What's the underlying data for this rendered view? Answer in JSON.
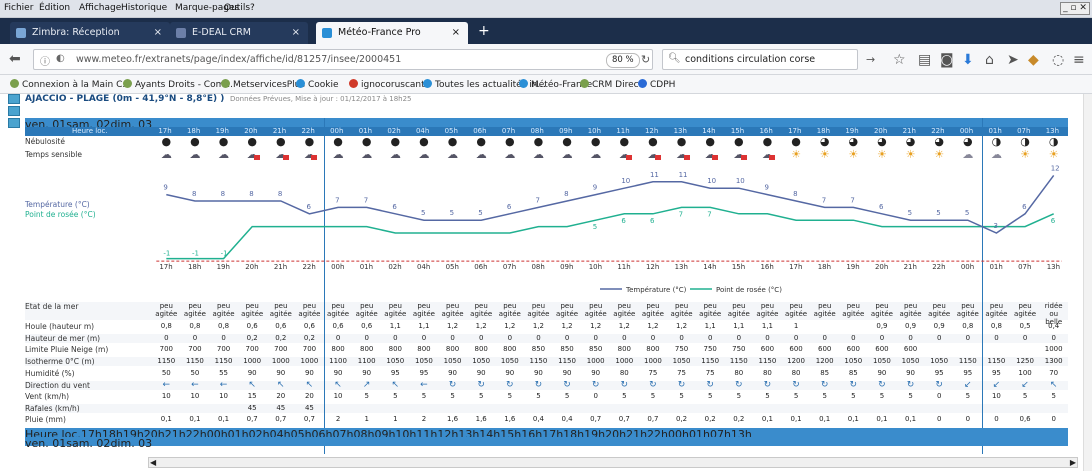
{
  "menu": [
    "Fichier",
    "Édition",
    "Affichage",
    "Historique",
    "Marque-pages",
    "Outils",
    "?"
  ],
  "tabs": [
    {
      "label": "Zimbra: Réception",
      "icon": "zimbra-icon",
      "color": "#7aa6d6",
      "active": false
    },
    {
      "label": "E-DEAL CRM",
      "icon": "edeal-icon",
      "color": "#6c7fa8",
      "active": false
    },
    {
      "label": "Météo-France Pro",
      "icon": "meteo-icon",
      "color": "#2a8fd6",
      "active": true
    }
  ],
  "nav": {
    "url": "www.meteo.fr/extranets/page/index/affiche/id/81257/insee/2000451",
    "zoom": "80 %",
    "search": "conditions circulation corse"
  },
  "bookmarks": [
    "Connexion à la Main C...",
    "Ayants Droits - Com...",
    "MetservicesPlus",
    "Cookie",
    "ignocoruscant",
    "Toutes les actualités in...",
    "Météo-France",
    "CRM Direct",
    "CDPH"
  ],
  "page": {
    "title": "AJACCIO - PLAGE (0m - 41,9°N - 8,8°E) )",
    "subtitle": "Données Prévues,      Mise à jour : 01/12/2017 à 18h25",
    "days": [
      {
        "label": "ven. 01",
        "span": 6
      },
      {
        "label": "sam. 02",
        "span": 23
      },
      {
        "label": "dim. 03",
        "span": 4
      }
    ],
    "hour_label": "Heure loc.",
    "hours": [
      "17h",
      "18h",
      "19h",
      "20h",
      "21h",
      "22h",
      "00h",
      "01h",
      "02h",
      "04h",
      "05h",
      "06h",
      "07h",
      "08h",
      "09h",
      "10h",
      "11h",
      "12h",
      "13h",
      "14h",
      "15h",
      "16h",
      "17h",
      "18h",
      "19h",
      "20h",
      "21h",
      "22h",
      "00h",
      "01h",
      "07h",
      "13h"
    ],
    "row_labels": {
      "nebulosite": "Nébulosité",
      "temps": "Temps sensible",
      "temperature": "Température (°C)",
      "rosee": "Point de rosée (°C)",
      "etat_mer": "Etat de la mer",
      "houle": "Houle (hauteur m)",
      "hauteur_mer": "Hauteur de mer (m)",
      "pluie_neige": "Limite Pluie Neige (m)",
      "isotherme": "Isotherme 0°C (m)",
      "humidite": "Humidité (%)",
      "direction_vent": "Direction du vent",
      "vent": "Vent (km/h)",
      "rafales": "Rafales (km/h)",
      "pluie": "Pluie (mm)"
    },
    "legend": {
      "temperature": "Température (°C)",
      "rosee": "Point de rosée (°C)"
    },
    "colors": {
      "header": "#2b78b8",
      "temp": "#5568a3",
      "dew": "#20b090",
      "freeze": "#cc3333"
    },
    "temperature": [
      9,
      8,
      8,
      8,
      8,
      6,
      7,
      7,
      6,
      5,
      5,
      5,
      6,
      7,
      8,
      9,
      10,
      11,
      11,
      10,
      10,
      9,
      8,
      7,
      7,
      6,
      5,
      5,
      5,
      3,
      6,
      12
    ],
    "temp_labels": [
      "9",
      "8",
      "8",
      "8",
      "8",
      "6",
      "7",
      "7",
      "6",
      "5",
      "5",
      "5",
      "6",
      "7",
      "8",
      "9",
      "10",
      "11",
      "11",
      "10",
      "10",
      "9",
      "8",
      "7",
      "7",
      "6",
      "5",
      "5",
      "5",
      "3",
      "6",
      "12"
    ],
    "dew": [
      -1,
      -1,
      -1,
      4,
      4,
      4,
      4,
      4,
      3,
      3,
      3,
      3,
      3,
      4,
      4,
      5,
      6,
      6,
      7,
      7,
      6,
      6,
      5,
      5,
      5,
      4,
      4,
      4,
      4,
      4,
      4,
      6
    ],
    "dew_labels": [
      "-1",
      "-1",
      "-1",
      "",
      "",
      "",
      "",
      "",
      "",
      "",
      "",
      "",
      "",
      "",
      "",
      "5",
      "6",
      "6",
      "7",
      "7",
      "",
      "",
      "",
      "",
      "",
      "",
      "",
      "",
      "",
      "",
      "",
      "6"
    ],
    "nebulosite": [
      "full",
      "full",
      "full",
      "full",
      "full",
      "full",
      "full",
      "full",
      "full",
      "full",
      "full",
      "full",
      "full",
      "full",
      "full",
      "full",
      "full",
      "full",
      "full",
      "full",
      "full",
      "full",
      "full",
      "3q",
      "3q",
      "3q",
      "3q",
      "3q",
      "3q",
      "half",
      "half",
      "half"
    ],
    "temps": [
      "rain",
      "rain",
      "rain",
      "storm",
      "storm",
      "storm",
      "rain",
      "rain",
      "rain",
      "rain",
      "rain",
      "rain",
      "rain",
      "rain",
      "rain",
      "rain",
      "storm",
      "storm",
      "storm",
      "storm",
      "storm",
      "storm",
      "sun",
      "sun",
      "sun",
      "sun",
      "sun",
      "sun",
      "wind",
      "wind",
      "sun",
      "sun"
    ],
    "etat_mer": [
      "peu agitée",
      "peu agitée",
      "peu agitée",
      "peu agitée",
      "peu agitée",
      "peu agitée",
      "peu agitée",
      "peu agitée",
      "peu agitée",
      "peu agitée",
      "peu agitée",
      "peu agitée",
      "peu agitée",
      "peu agitée",
      "peu agitée",
      "peu agitée",
      "peu agitée",
      "peu agitée",
      "peu agitée",
      "peu agitée",
      "peu agitée",
      "peu agitée",
      "peu agitée",
      "peu agitée",
      "peu agitée",
      "peu agitée",
      "peu agitée",
      "peu agitée",
      "peu agitée",
      "peu agitée",
      "peu agitée",
      "ridée ou belle"
    ],
    "houle": [
      "0,8",
      "0,8",
      "0,8",
      "0,6",
      "0,6",
      "0,6",
      "0,6",
      "0,6",
      "1,1",
      "1,1",
      "1,2",
      "1,2",
      "1,2",
      "1,2",
      "1,2",
      "1,2",
      "1,2",
      "1,2",
      "1,2",
      "1,1",
      "1,1",
      "1,1",
      "1",
      "",
      "",
      "0,9",
      "0,9",
      "0,9",
      "0,8",
      "0,8",
      "0,5",
      "0,4"
    ],
    "hauteur_mer": [
      "0",
      "0",
      "0",
      "0,2",
      "0,2",
      "0,2",
      "0",
      "0",
      "0",
      "0",
      "0",
      "0",
      "0",
      "0",
      "0",
      "0",
      "0",
      "0",
      "0",
      "0",
      "0",
      "0",
      "0",
      "0",
      "0",
      "0",
      "0",
      "0",
      "0",
      "0",
      "0",
      "0"
    ],
    "pluie_neige": [
      "700",
      "700",
      "700",
      "700",
      "700",
      "700",
      "800",
      "800",
      "800",
      "800",
      "800",
      "800",
      "800",
      "850",
      "850",
      "850",
      "800",
      "800",
      "750",
      "750",
      "750",
      "600",
      "600",
      "600",
      "600",
      "600",
      "600",
      "",
      "",
      "",
      "",
      "1000"
    ],
    "isotherme": [
      "1150",
      "1150",
      "1150",
      "1000",
      "1000",
      "1000",
      "1100",
      "1100",
      "1050",
      "1050",
      "1050",
      "1050",
      "1050",
      "1150",
      "1150",
      "1000",
      "1000",
      "1000",
      "1050",
      "1150",
      "1150",
      "1150",
      "1200",
      "1200",
      "1050",
      "1050",
      "1050",
      "1050",
      "1150",
      "1150",
      "1250",
      "1300"
    ],
    "humidite": [
      "50",
      "50",
      "55",
      "90",
      "90",
      "90",
      "90",
      "90",
      "95",
      "95",
      "90",
      "90",
      "90",
      "90",
      "90",
      "90",
      "80",
      "75",
      "75",
      "75",
      "80",
      "80",
      "80",
      "85",
      "85",
      "90",
      "90",
      "95",
      "95",
      "95",
      "100",
      "70"
    ],
    "direction_vent": [
      "←",
      "←",
      "←",
      "↖",
      "↖",
      "↖",
      "↖",
      "↗",
      "↖",
      "←",
      "↻",
      "↻",
      "↻",
      "↻",
      "↻",
      "↻",
      "↻",
      "↻",
      "↻",
      "↻",
      "↻",
      "↻",
      "↻",
      "↻",
      "↻",
      "↻",
      "↻",
      "↻",
      "↙",
      "↙",
      "↙",
      "↖"
    ],
    "vent": [
      "10",
      "10",
      "10",
      "15",
      "20",
      "20",
      "10",
      "5",
      "5",
      "5",
      "5",
      "5",
      "5",
      "5",
      "5",
      "0",
      "5",
      "5",
      "5",
      "5",
      "5",
      "5",
      "5",
      "5",
      "5",
      "5",
      "5",
      "0",
      "5",
      "10",
      "5",
      "5"
    ],
    "rafales": [
      "",
      "",
      "",
      "45",
      "45",
      "45",
      "",
      "",
      "",
      "",
      "",
      "",
      "",
      "",
      "",
      "",
      "",
      "",
      "",
      "",
      "",
      "",
      "",
      "",
      "",
      "",
      "",
      "",
      "",
      "",
      "",
      ""
    ],
    "pluie": [
      "0,1",
      "0,1",
      "0,1",
      "0,7",
      "0,7",
      "0,7",
      "2",
      "1",
      "1",
      "2",
      "1,6",
      "1,6",
      "1,6",
      "0,4",
      "0,4",
      "0,7",
      "0,7",
      "0,7",
      "0,2",
      "0,2",
      "0,2",
      "0,1",
      "0,1",
      "0,1",
      "0,1",
      "0,1",
      "0,1",
      "0",
      "0",
      "0",
      "0,6",
      "0"
    ]
  }
}
